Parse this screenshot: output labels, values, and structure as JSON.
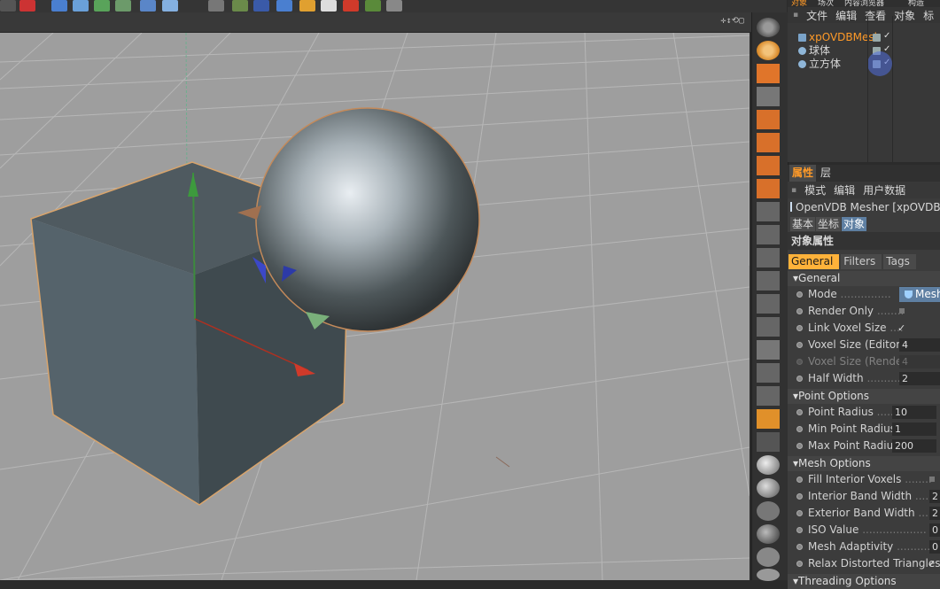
{
  "object_manager": {
    "tabs": [
      "对象",
      "场次",
      "内容浏览器",
      "构造"
    ],
    "menu": [
      "文件",
      "编辑",
      "查看",
      "对象",
      "标"
    ],
    "objects": [
      {
        "name": "xpOVDBMesl",
        "selected": true
      },
      {
        "name": "球体",
        "selected": false
      },
      {
        "name": "立方体",
        "selected": false
      }
    ]
  },
  "attribute_manager": {
    "tabs": [
      "属性",
      "层"
    ],
    "menu": [
      "模式",
      "编辑",
      "用户数据"
    ],
    "object_title": "OpenVDB Mesher [xpOVDBM",
    "subtabs": [
      "基本",
      "坐标",
      "对象"
    ],
    "active_subtab": "对象",
    "heading": "对象属性",
    "inner_tabs": [
      "General",
      "Filters",
      "Tags"
    ],
    "active_inner_tab": "General",
    "groups": {
      "general": {
        "title": "General",
        "mode_label": "Mode",
        "mode_value": "Mesh",
        "render_only": "Render Only",
        "link_voxel": "Link Voxel Size",
        "voxel_editor_label": "Voxel Size (Editor)",
        "voxel_editor_value": "4",
        "voxel_render_label": "Voxel Size (Render)",
        "voxel_render_value": "4",
        "half_width_label": "Half Width",
        "half_width_value": "2"
      },
      "point": {
        "title": "Point Options",
        "radius_label": "Point Radius",
        "radius_value": "10",
        "min_label": "Min Point Radius",
        "min_value": "1",
        "max_label": "Max Point Radius",
        "max_value": "200"
      },
      "mesh": {
        "title": "Mesh Options",
        "fill_label": "Fill Interior Voxels",
        "interior_label": "Interior Band Width",
        "interior_value": "2",
        "exterior_label": "Exterior Band Width",
        "exterior_value": "2",
        "iso_label": "ISO Value",
        "iso_value": "0",
        "adapt_label": "Mesh Adaptivity",
        "adapt_value": "0",
        "relax_label": "Relax Distorted Triangles"
      },
      "threading": {
        "title": "Threading Options"
      }
    }
  },
  "colors": {
    "selection": "#ff9a28",
    "active_tab": "#ffb23a",
    "field_blue": "#5e7fa2",
    "viewport": "#9b9b9b"
  }
}
